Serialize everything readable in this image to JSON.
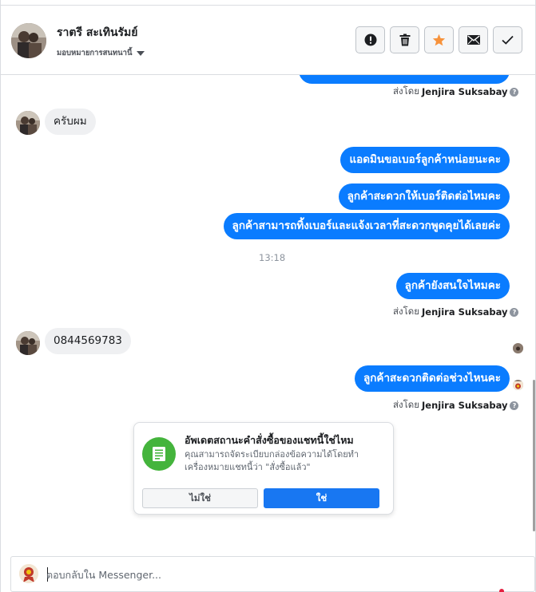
{
  "header": {
    "contact_name": "ราตรี สะเทินรัมย์",
    "assign_label": "มอบหมายการสนทนานี้",
    "actions": [
      {
        "name": "spam-button",
        "icon": "exclamation-icon"
      },
      {
        "name": "delete-button",
        "icon": "trash-icon"
      },
      {
        "name": "star-button",
        "icon": "star-icon"
      },
      {
        "name": "mark-unread-button",
        "icon": "envelope-icon"
      },
      {
        "name": "mark-done-button",
        "icon": "checkmark-icon"
      }
    ]
  },
  "messages": {
    "sent_by_prefix": "ส่งโดย",
    "agent_name": "Jenjira Suksabay",
    "in_1": "ครับผม",
    "out_1": "แอดมินขอเบอร์ลูกค้าหน่อยนะคะ",
    "out_2": "ลูกค้าสะดวกให้เบอร์ติดต่อไหมคะ",
    "out_3": "ลูกค้าสามารถทิ้งเบอร์และแจ้งเวลาที่สะดวกพูดคุยได้เลยค่ะ",
    "time_1": "13:18",
    "out_4": "ลูกค้ายังสนใจไหมคะ",
    "in_2": "0844569783",
    "out_5": "ลูกค้าสะดวกติดต่อช่วงไหนคะ"
  },
  "prompt_card": {
    "title": "อัพเดตสถานะคำสั่งซื้อของแชทนี้ใช่ไหม",
    "description": "คุณสามารถจัดระเบียบกล่องข้อความได้โดยทำเครื่องหมายแชทนี้ว่า \"สั่งซื้อแล้ว\"",
    "no_label": "ไม่ใช่",
    "yes_label": "ใช่",
    "icon": "order-receipt-icon"
  },
  "reply": {
    "placeholder": "ตอบกลับใน Messenger..."
  },
  "colors": {
    "outgoing_bubble": "#0a7cff",
    "incoming_bubble": "#eff0f2",
    "star": "#f7923b",
    "card_icon": "#44b43c",
    "primary_button": "#1877f2"
  }
}
